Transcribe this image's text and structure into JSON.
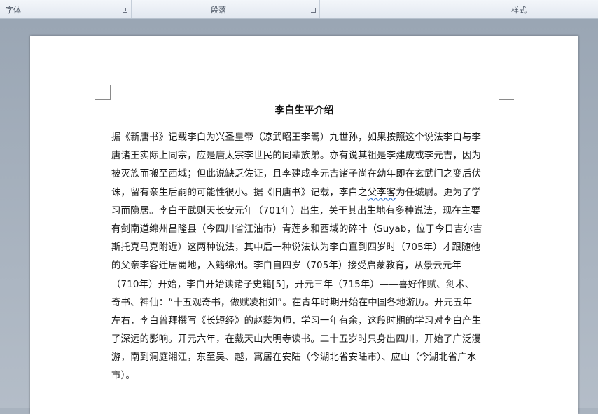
{
  "ribbon": {
    "group_font": "字体",
    "group_paragraph": "段落",
    "group_styles": "样式"
  },
  "document": {
    "title": "李白生平介绍",
    "lines": [
      "据《新唐书》记载李白为兴圣皇帝（凉武昭王李暠）九世孙，如果按照这个说法李白与李",
      "唐诸王实际上同宗，应是唐太宗李世民的同辈族弟。亦有说其祖是李建成或李元吉，因为",
      "被灭族而搬至西域；但此说缺乏佐证，且李建成李元吉诸子尚在幼年即在玄武门之变后伏",
      "诛，留有亲生后嗣的可能性很小。据《旧唐书》记载，李白之",
      "为任城尉。更为了学",
      "习而隐居。李白于武则天长安元年（701年）出生，关于其出生地有多种说法，现在主要",
      "有剑南道绵州昌隆县（今四川省江油市）青莲乡和西域的碎叶（Suyab，位于今日吉尔吉",
      "斯托克马克附近）这两种说法，其中后一种说法认为李白直到四岁时（705年）才跟随他",
      "的父亲李客迁居蜀地，入籍绵州。李白自四岁（705年）接受启蒙教育，从景云元年",
      "（710年）开始，李白开始读诸子史籍[5]，开元三年（715年）——喜好作赋、剑术、",
      "奇书、神仙：“十五观奇书，做赋凌相如”。在青年时期开始在中国各地游历。开元五年",
      "左右，李白曾拜撰写《长短经》的赵蕤为师，学习一年有余，这段时期的学习对李白产生",
      "了深远的影响。开元六年，在戴天山大明寺读书。二十五岁时只身出四川，开始了广泛漫",
      "游，南到洞庭湘江，东至吴、越，寓居在安陆（今湖北省安陆市）、应山（今湖北省广水",
      "市）。"
    ],
    "flagged_phrase": "父李客"
  }
}
